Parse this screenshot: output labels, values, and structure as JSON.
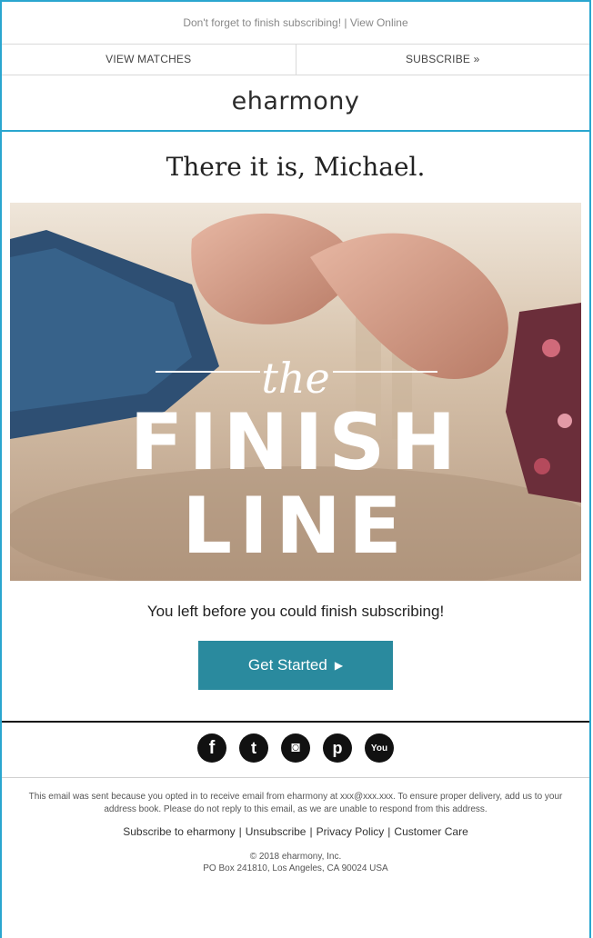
{
  "preheader": {
    "reminder": "Don't forget to finish subscribing!",
    "separator": "|",
    "view_online": "View Online"
  },
  "nav": {
    "view_matches": "VIEW MATCHES",
    "subscribe": "SUBSCRIBE »"
  },
  "brand": {
    "logo_text": "eharmony",
    "accent_color": "#2aa6cf",
    "button_color": "#2a8a9e"
  },
  "main": {
    "greeting": "There it is, Michael.",
    "hero": {
      "the": "the",
      "finish": "FINISH",
      "line": "LINE"
    },
    "subtitle": "You left before you could finish subscribing!",
    "cta": {
      "label": "Get Started",
      "arrow": "▶"
    }
  },
  "social": {
    "icons": [
      {
        "name": "facebook-icon",
        "glyph": "f"
      },
      {
        "name": "twitter-icon",
        "glyph": "t"
      },
      {
        "name": "instagram-icon",
        "glyph": "◙"
      },
      {
        "name": "pinterest-icon",
        "glyph": "p"
      },
      {
        "name": "youtube-icon",
        "glyph": "You"
      }
    ]
  },
  "footer": {
    "legal_line1": "This email was sent because you opted in to receive email from eharmony at xxx@xxx.xxx. To ensure proper delivery, add us to your",
    "legal_line2": "address book. Please do not reply to this email, as we are unable to respond from this address.",
    "links": [
      "Subscribe to eharmony",
      "Unsubscribe",
      "Privacy Policy",
      "Customer Care"
    ],
    "copyright": "© 2018 eharmony, Inc.",
    "address": "PO Box 241810, Los Angeles, CA 90024 USA"
  }
}
